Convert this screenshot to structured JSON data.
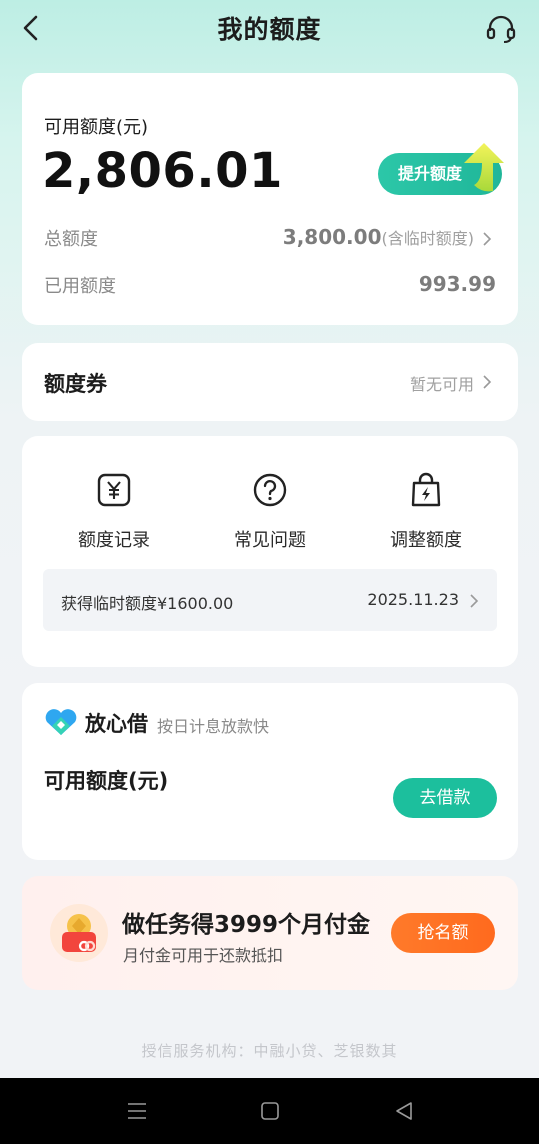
{
  "header": {
    "title": "我的额度",
    "back_icon": "chevron-left-icon",
    "support_icon": "headset-icon"
  },
  "credit": {
    "available_label": "可用额度(元)",
    "available_value": "2,806.01",
    "boost_label": "提升额度",
    "total_label": "总额度",
    "total_value": "3,800.00",
    "total_note": "(含临时额度)",
    "used_label": "已用额度",
    "used_value": "993.99"
  },
  "coupon": {
    "title": "额度券",
    "status": "暂无可用"
  },
  "actions": [
    {
      "label": "额度记录",
      "icon": "yen-receipt-icon"
    },
    {
      "label": "常见问题",
      "icon": "question-circle-icon"
    },
    {
      "label": "调整额度",
      "icon": "lightning-bag-icon"
    }
  ],
  "notice": {
    "text": "获得临时额度¥1600.00",
    "date": "2025.11.23"
  },
  "loan": {
    "brand_name": "放心借",
    "brand_sub": "按日计息放款快",
    "available_label": "可用额度(元)",
    "button_label": "去借款"
  },
  "task": {
    "title": "做任务得3999个月付金",
    "subtitle": "月付金可用于还款抵扣",
    "button_label": "抢名额"
  },
  "footer": {
    "text": "授信服务机构：中融小贷、芝银数其"
  },
  "colors": {
    "accent": "#1cbf9d",
    "orange": "#ff7224",
    "bg_top": "#bdeee4"
  }
}
